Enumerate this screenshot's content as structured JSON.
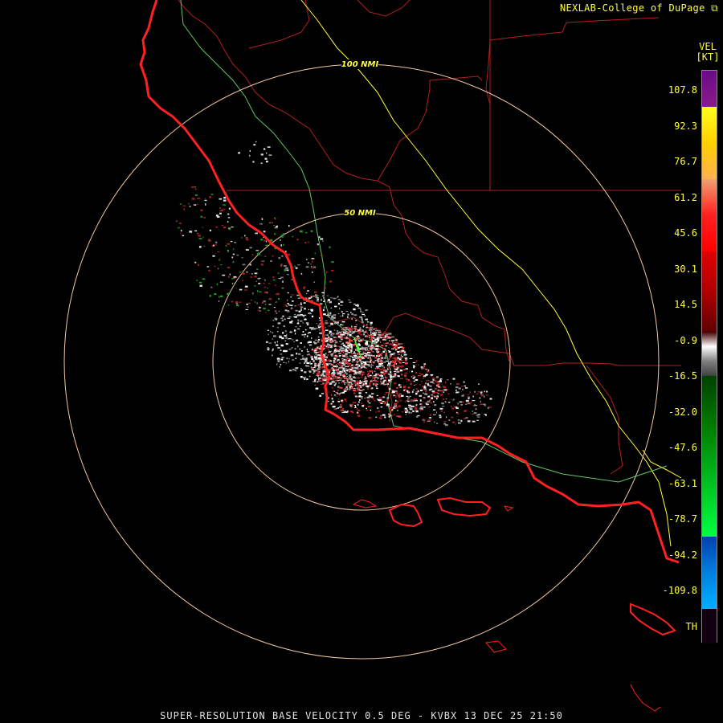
{
  "credit": "NEXLAB-College of DuPage",
  "legend": {
    "title": "VEL",
    "units": "[KT]",
    "ticks": [
      "107.8",
      "92.3",
      "76.7",
      "61.2",
      "45.6",
      "30.1",
      "14.5",
      "-0.9",
      "-16.5",
      "-32.0",
      "-47.6",
      "-63.1",
      "-78.7",
      "-94.2",
      "-109.8",
      "TH"
    ],
    "colors": [
      "#7a0a7a",
      "#ffff00",
      "#f09a6a",
      "#ff0000",
      "#8a0000",
      "#ffffff",
      "#888888",
      "#006a00",
      "#00ff40",
      "#0050c8",
      "#00b0ff",
      "#100010"
    ]
  },
  "range_rings": [
    "100 NMI",
    "50 NMI"
  ],
  "footer": "SUPER-RESOLUTION BASE VELOCITY 0.5 DEG - KVBX 13 DEC 25 21:50",
  "colors": {
    "coast": "#ff2020",
    "counties": "#b02020",
    "ring": "#f0c8a0",
    "highway_yellow": "#ffff40",
    "highway_green": "#60c860",
    "label": "#ffff40"
  }
}
